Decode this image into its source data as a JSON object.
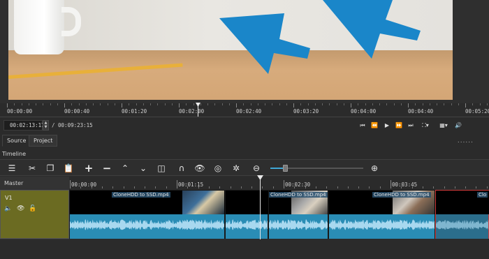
{
  "preview": {
    "ruler_labels": [
      "00:00:00",
      "00:00:40",
      "00:01:20",
      "00:02:00",
      "00:02:40",
      "00:03:20",
      "00:04:00",
      "00:04:40",
      "00:05:20"
    ]
  },
  "transport": {
    "current_timecode": "00:02:13:17",
    "total_duration": "/ 00:09:23:15",
    "buttons": [
      "skip-to-start",
      "rewind",
      "play",
      "fast-forward",
      "skip-to-end",
      "zoom",
      "grid",
      "volume"
    ]
  },
  "tabs": {
    "source": "Source",
    "project": "Project"
  },
  "dots": "......",
  "timeline": {
    "label": "Timeline",
    "master": "Master",
    "track_name": "V1",
    "ruler_labels": [
      "00:00:00",
      "00:01:15",
      "00:02:30",
      "00:03:45"
    ],
    "clips": [
      {
        "name": "CloneHDD to SSD.mp4"
      },
      {
        "name": ""
      },
      {
        "name": "CloneHDD to SSD.mp4"
      },
      {
        "name": "CloneHDD to SSD.mp4"
      },
      {
        "name": "Clo"
      }
    ]
  },
  "toolbar": {
    "tools": [
      "menu-icon",
      "scissors-icon",
      "copy-icon",
      "paste-icon",
      "plus-icon",
      "minus-icon",
      "chevron-up-icon",
      "chevron-down-icon",
      "split-icon",
      "magnet-icon",
      "eye-icon",
      "target-icon",
      "asterisk-icon",
      "zoom-out-icon",
      "zoom-in-icon"
    ]
  },
  "colors": {
    "accent": "#2a8db5",
    "track_header": "#6b6b22",
    "selected_clip": "#d23a3a"
  }
}
